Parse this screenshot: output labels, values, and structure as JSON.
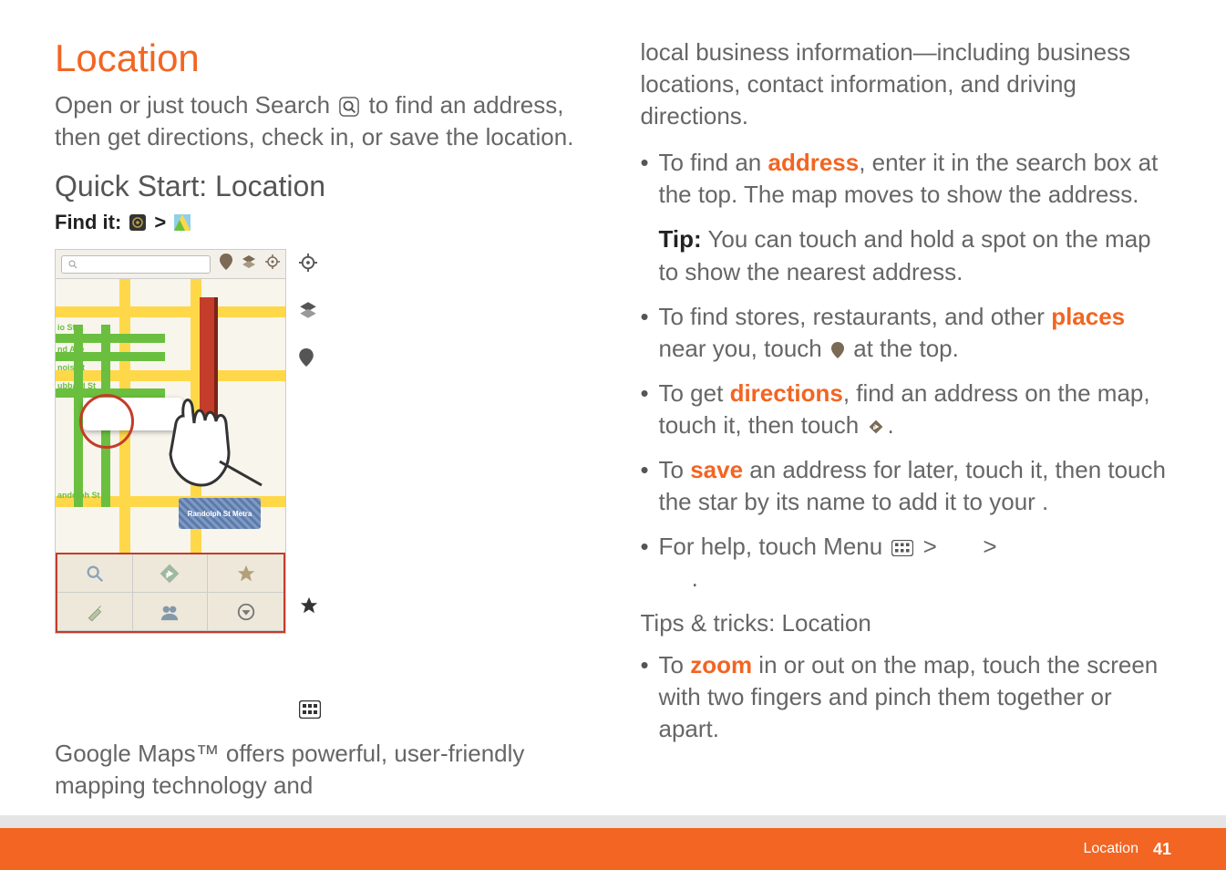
{
  "title": "Location",
  "intro_parts": {
    "open": "Open ",
    "or_touch": " or just touch Search ",
    "to_find": " to find an address, then get directions, check in, or save the location."
  },
  "quick_start": "Quick Start: Location",
  "find_it_label": "Find it:",
  "find_it_sep": ">",
  "gm_intro": "Google Maps™ offers powerful, user-friendly mapping technology and ",
  "right_intro": "local business information—including business locations, contact information, and driving directions.",
  "bullets": [
    {
      "pre": "To find an ",
      "em": "address",
      "post": ", enter it in the search box at the top. The map moves to show the address."
    }
  ],
  "tip_label": "Tip:",
  "tip_text": " You can touch and hold a spot on the map to show the nearest address.",
  "bullet_places_pre": "To find stores, restaurants, and other ",
  "bullet_places_em": "places",
  "bullet_places_post": " near you, touch ",
  "bullet_places_end": " at the top.",
  "bullet_dir_pre": "To get ",
  "bullet_dir_em": "directions",
  "bullet_dir_post": ", find an address on the map, touch it, then touch ",
  "bullet_dir_end": ".",
  "bullet_save_pre": "To ",
  "bullet_save_em": "save",
  "bullet_save_post": " an address for later, touch it, then touch the star by its name to add it to your ",
  "bullet_save_end": ".",
  "bullet_help_pre": "For help, touch Menu ",
  "gt": ">",
  "bullet_help_end": ".",
  "tips_tricks": "Tips & tricks: Location",
  "bullet_zoom_pre": "To ",
  "bullet_zoom_em": "zoom",
  "bullet_zoom_post": " in or out on the map, touch the screen with two fingers and pinch them together or apart.",
  "map": {
    "street1": "io St",
    "street2": "nd Ave",
    "street3": "nois St",
    "street4": "ubbard St",
    "street5": "andolph St",
    "block_label": "Randolph St Metra"
  },
  "footer": {
    "label": "Location",
    "page": "41"
  }
}
